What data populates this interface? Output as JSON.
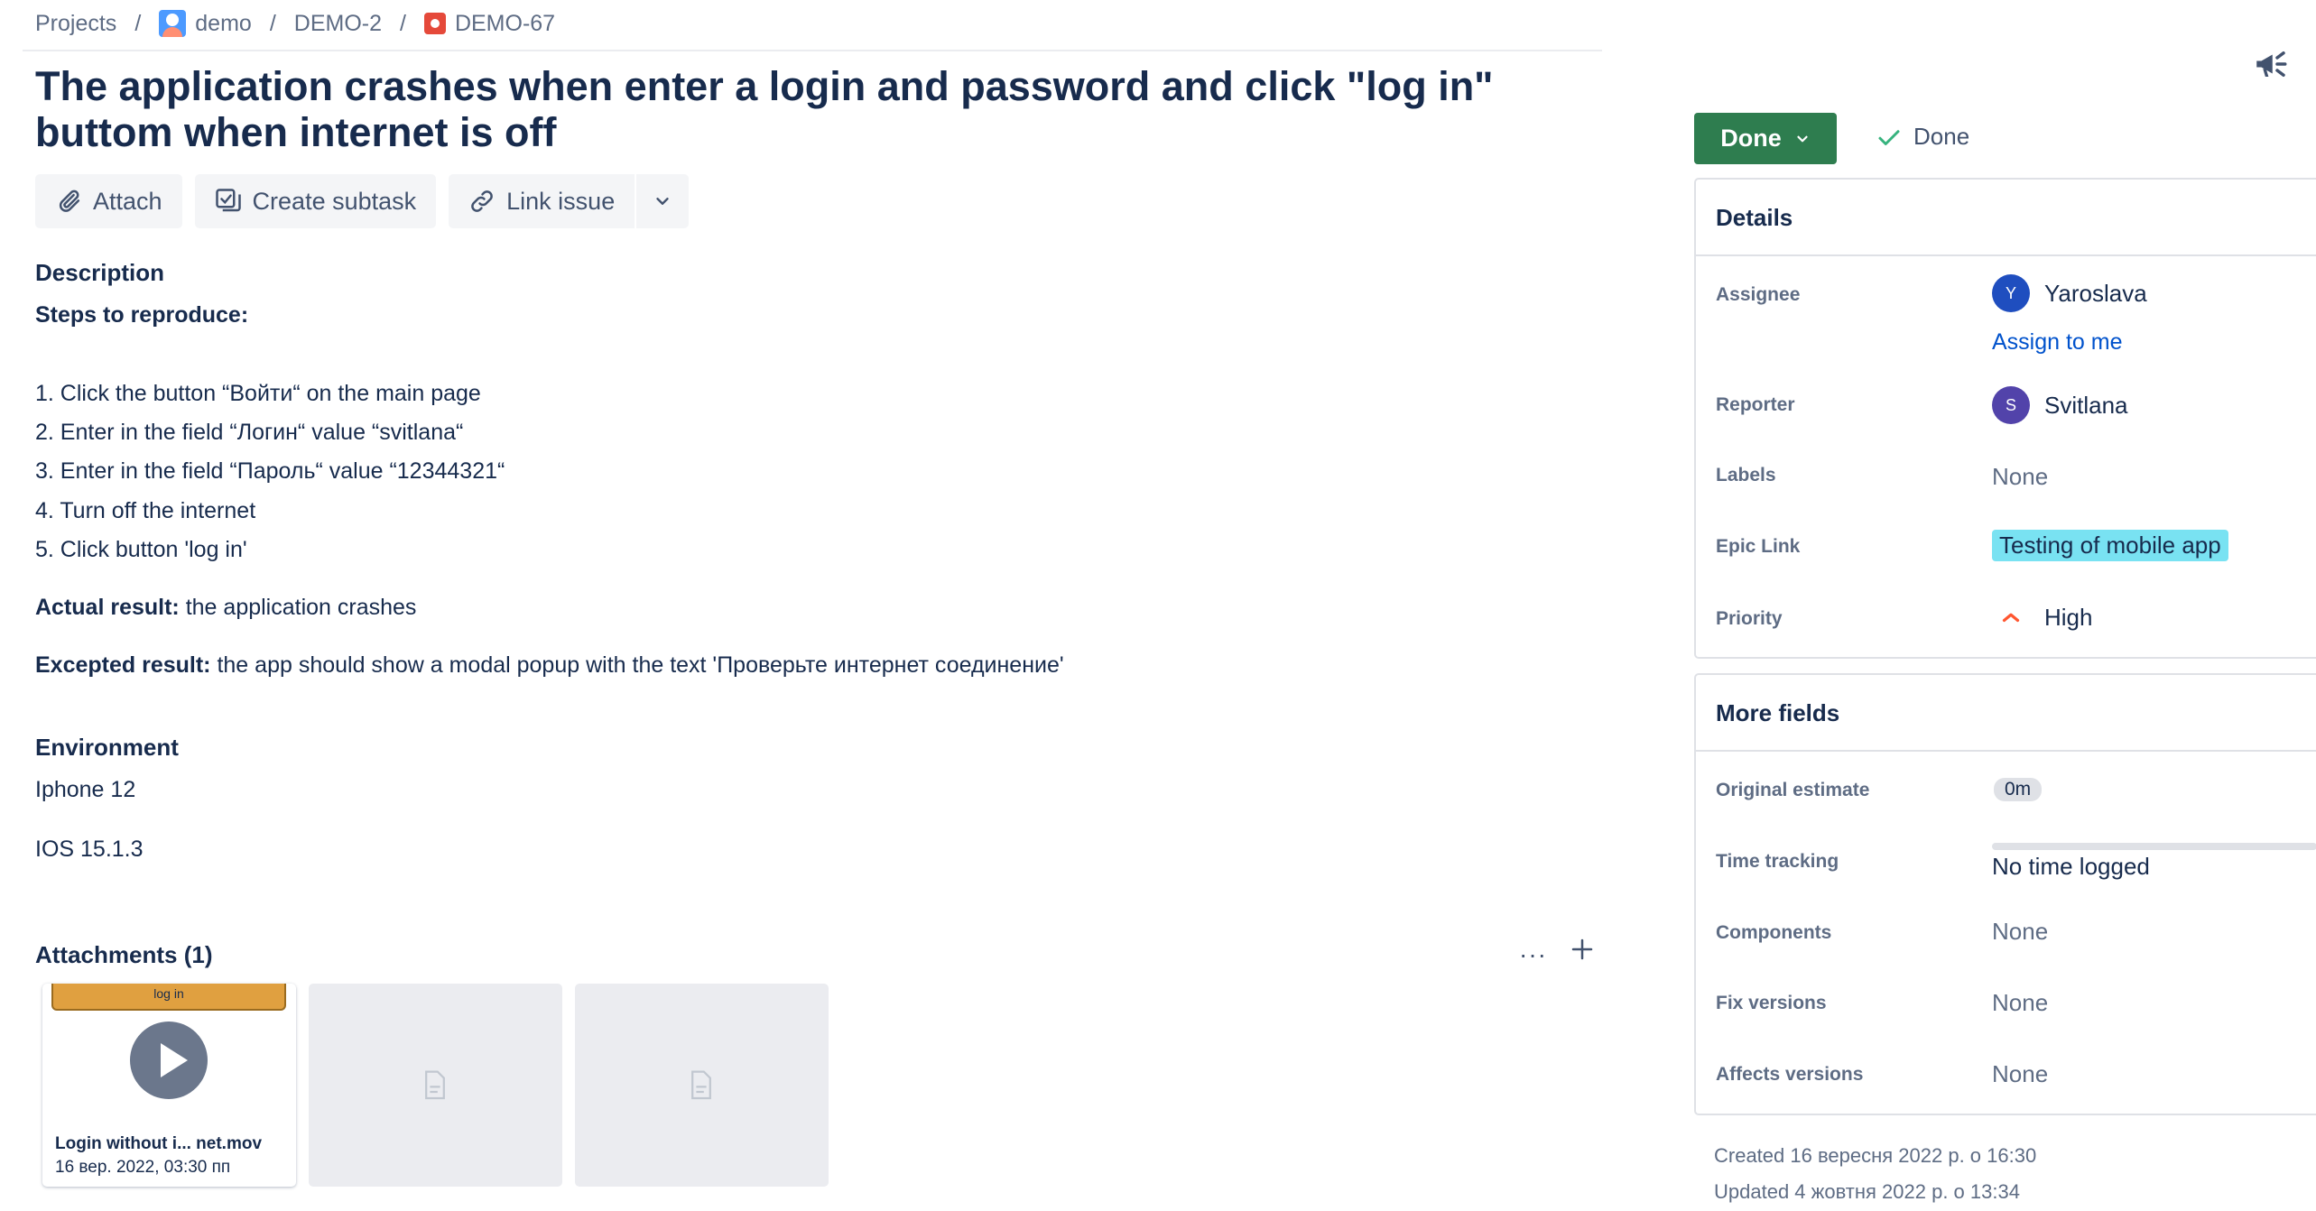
{
  "breadcrumb": {
    "projects": "Projects",
    "project": "demo",
    "epic": "DEMO-2",
    "issue": "DEMO-67",
    "separator": "/"
  },
  "issue": {
    "title": "The application crashes when enter a login and password and click \"log in\" buttom when internet is off"
  },
  "toolbar": {
    "attach": "Attach",
    "create_subtask": "Create subtask",
    "link_issue": "Link issue"
  },
  "description": {
    "heading": "Description",
    "steps_heading": "Steps to reproduce:",
    "steps": [
      "1. Click the button “Войти“ on the main page",
      "2. Enter in the field “Логин“ value “svitlana“",
      "3. Enter in the field “Пароль“ value “12344321“",
      "4. Turn off the internet",
      "5. Click button 'log in'"
    ],
    "actual_label": "Actual result:",
    "actual_text": " the application crashes",
    "expected_label": "Excepted result:",
    "expected_text": " the app should show a modal popup with the text 'Проверьте интернет соединение'"
  },
  "environment": {
    "heading": "Environment",
    "lines": [
      "Iphone 12",
      "IOS 15.1.3"
    ]
  },
  "attachments": {
    "heading": "Attachments (1)",
    "more": "···",
    "items": [
      {
        "thumb_label": "log in",
        "name": "Login without i... net.mov",
        "date": "16 вер. 2022, 03:30 пп"
      }
    ]
  },
  "status": {
    "button_label": "Done",
    "resolution": "Done",
    "button_color": "#2E7D4F"
  },
  "details": {
    "heading": "Details",
    "assignee_label": "Assignee",
    "assignee_initial": "Y",
    "assignee_name": "Yaroslava",
    "assign_to_me": "Assign to me",
    "reporter_label": "Reporter",
    "reporter_initial": "S",
    "reporter_name": "Svitlana",
    "labels_label": "Labels",
    "labels_value": "None",
    "epic_label": "Epic Link",
    "epic_value": "Testing of mobile app",
    "priority_label": "Priority",
    "priority_value": "High"
  },
  "more_fields": {
    "heading": "More fields",
    "original_estimate_label": "Original estimate",
    "original_estimate_value": "0m",
    "time_tracking_label": "Time tracking",
    "time_tracking_value": "No time logged",
    "components_label": "Components",
    "components_value": "None",
    "fix_versions_label": "Fix versions",
    "fix_versions_value": "None",
    "affects_versions_label": "Affects versions",
    "affects_versions_value": "None"
  },
  "meta": {
    "created": "Created 16 вересня 2022 р. о 16:30",
    "updated": "Updated 4 жовтня 2022 р. о 13:34"
  }
}
